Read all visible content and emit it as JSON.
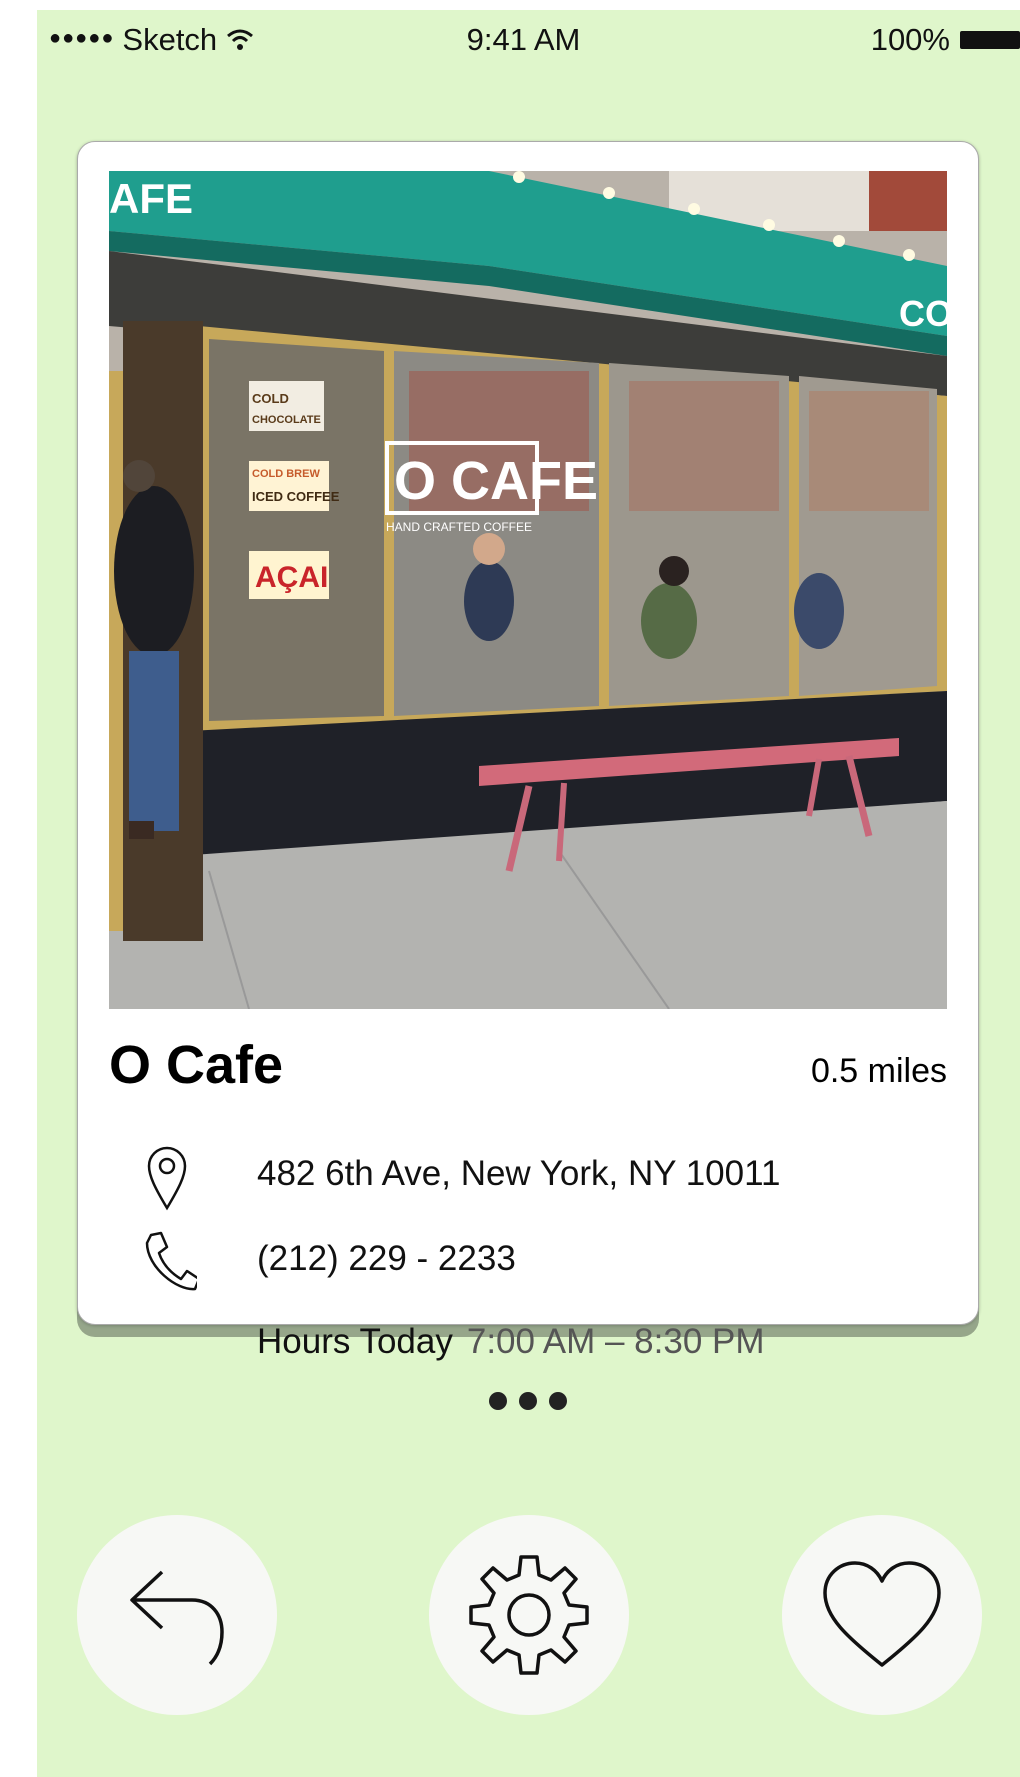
{
  "status_bar": {
    "carrier": "Sketch",
    "time": "9:41 AM",
    "battery": "100%"
  },
  "card": {
    "photo_alt": "O Cafe storefront",
    "name": "O Cafe",
    "distance": "0.5 miles",
    "address": "482 6th Ave, New York, NY 10011",
    "phone": "(212) 229 - 2233",
    "hours_label": "Hours Today",
    "hours_value": "7:00 AM – 8:30 PM",
    "storefront_sign": "O CAFE",
    "storefront_subsign": "HAND CRAFTED COFFEE",
    "window_signs": [
      "COLD CHOCOLATE",
      "COLD BREW ICED COFFEE",
      "AÇAI"
    ]
  },
  "actions": [
    {
      "name": "back",
      "icon": "reply-arrow-icon"
    },
    {
      "name": "settings",
      "icon": "gear-icon"
    },
    {
      "name": "favorite",
      "icon": "heart-icon"
    }
  ],
  "colors": {
    "background": "#dff6cb",
    "card": "#ffffff",
    "awning": "#1f9e8e",
    "button": "#f7f8f5"
  }
}
